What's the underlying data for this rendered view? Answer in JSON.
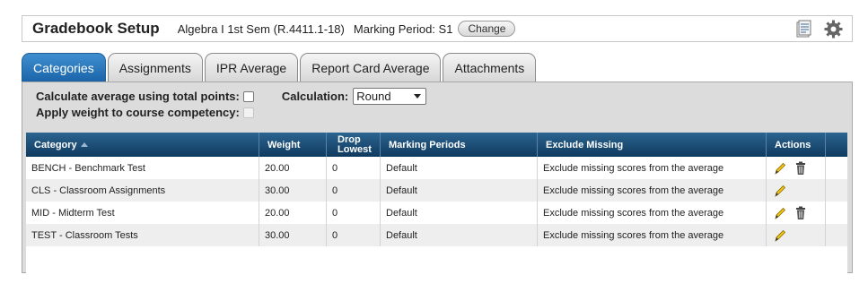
{
  "header": {
    "title": "Gradebook Setup",
    "course": "Algebra I 1st Sem (R.4411.1-18)",
    "marking_period": "Marking Period: S1",
    "change_label": "Change",
    "icons": [
      "report-icon",
      "gear-icon"
    ]
  },
  "tabs": [
    {
      "label": "Categories",
      "active": true
    },
    {
      "label": "Assignments",
      "active": false
    },
    {
      "label": "IPR Average",
      "active": false
    },
    {
      "label": "Report Card Average",
      "active": false
    },
    {
      "label": "Attachments",
      "active": false
    }
  ],
  "options": {
    "total_points_label": "Calculate average using total points:",
    "total_points_checked": false,
    "calculation_label": "Calculation:",
    "calculation_value": "Round",
    "weight_label": "Apply weight to course competency:",
    "weight_checked": false,
    "weight_disabled": true
  },
  "table": {
    "columns": [
      "Category",
      "Weight",
      "Drop",
      "Lowest",
      "Marking Periods",
      "Exclude Missing",
      "Actions"
    ],
    "rows": [
      {
        "category": "BENCH - Benchmark Test",
        "weight": "20.00",
        "drop": "0",
        "periods": "Default",
        "exclude": "Exclude missing scores from the average",
        "deletable": true
      },
      {
        "category": "CLS - Classroom Assignments",
        "weight": "30.00",
        "drop": "0",
        "periods": "Default",
        "exclude": "Exclude missing scores from the average",
        "deletable": false
      },
      {
        "category": "MID - Midterm Test",
        "weight": "20.00",
        "drop": "0",
        "periods": "Default",
        "exclude": "Exclude missing scores from the average",
        "deletable": true
      },
      {
        "category": "TEST - Classroom Tests",
        "weight": "30.00",
        "drop": "0",
        "periods": "Default",
        "exclude": "Exclude missing scores from the average",
        "deletable": false
      }
    ]
  },
  "colors": {
    "active_tab": "#1a63a8",
    "table_header": "#103a5f",
    "panel_bg": "#dcdcdc",
    "edit_icon": "#e0b400",
    "trash_icon": "#555555"
  }
}
